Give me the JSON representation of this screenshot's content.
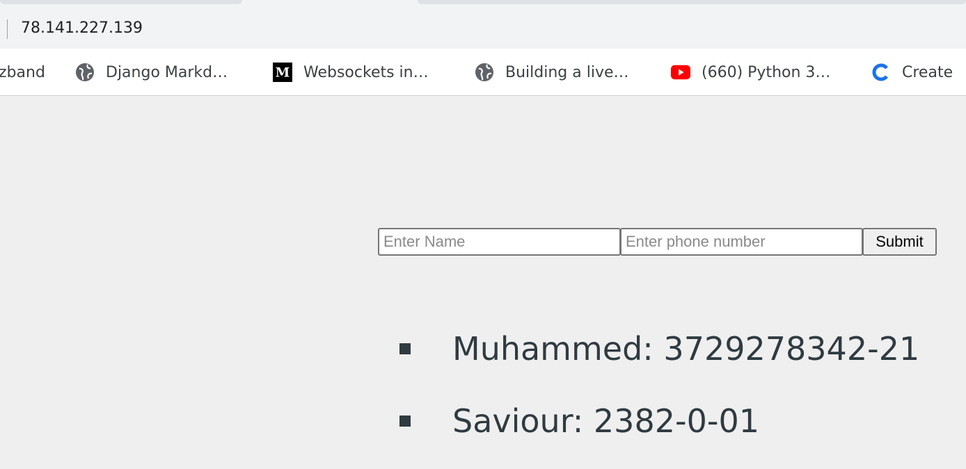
{
  "browser": {
    "url": "78.141.227.139",
    "bookmarks": [
      {
        "label": "zband",
        "icon": "none"
      },
      {
        "label": "Django Markd…",
        "icon": "globe-icon"
      },
      {
        "label": "Websockets in…",
        "icon": "medium-icon"
      },
      {
        "label": "Building a live…",
        "icon": "globe-icon"
      },
      {
        "label": "(660) Python 3…",
        "icon": "youtube-icon"
      },
      {
        "label": "Create",
        "icon": "c-logo-icon"
      }
    ]
  },
  "form": {
    "name_placeholder": "Enter Name",
    "phone_placeholder": "Enter phone number",
    "submit_label": "Submit"
  },
  "contacts": [
    {
      "text": "Muhammed: 3729278342-21"
    },
    {
      "text": "Saviour: 2382-0-01"
    }
  ],
  "colors": {
    "page_background": "#efefef",
    "text": "#2f3b40",
    "youtube_red": "#ff0000",
    "chrome_c_blue": "#1a73e8"
  }
}
